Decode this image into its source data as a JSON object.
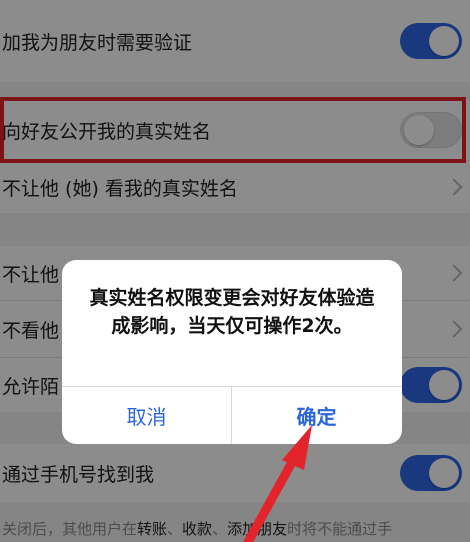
{
  "settings": {
    "verify_friend": {
      "label": "加我为朋友时需要验证",
      "enabled": true
    },
    "show_real_name": {
      "label": "向好友公开我的真实姓名",
      "enabled": false
    },
    "hide_real_name_from": {
      "label": "不让他 (她) 看我的真实姓名"
    },
    "hidden_row_1": {
      "label": "不让他"
    },
    "hidden_row_2": {
      "label": "不看他"
    },
    "hidden_row_3": {
      "label": "允许陌",
      "enabled": true
    },
    "find_by_phone": {
      "label": "通过手机号找到我",
      "enabled": true
    }
  },
  "footnote": {
    "prefix": "关闭后，其他用户在",
    "k1": "转账",
    "sep1": "、",
    "k2": "收款",
    "sep2": "、",
    "k3": "添加朋友",
    "suffix": "时将不能通过手"
  },
  "dialog": {
    "message": "真实姓名权限变更会对好友体验造成影响，当天仅可操作2次。",
    "cancel_label": "取消",
    "confirm_label": "确定"
  },
  "colors": {
    "toggle_on": "#2f66e6",
    "highlight": "#e3242b",
    "dialog_button": "#2a66d9"
  }
}
